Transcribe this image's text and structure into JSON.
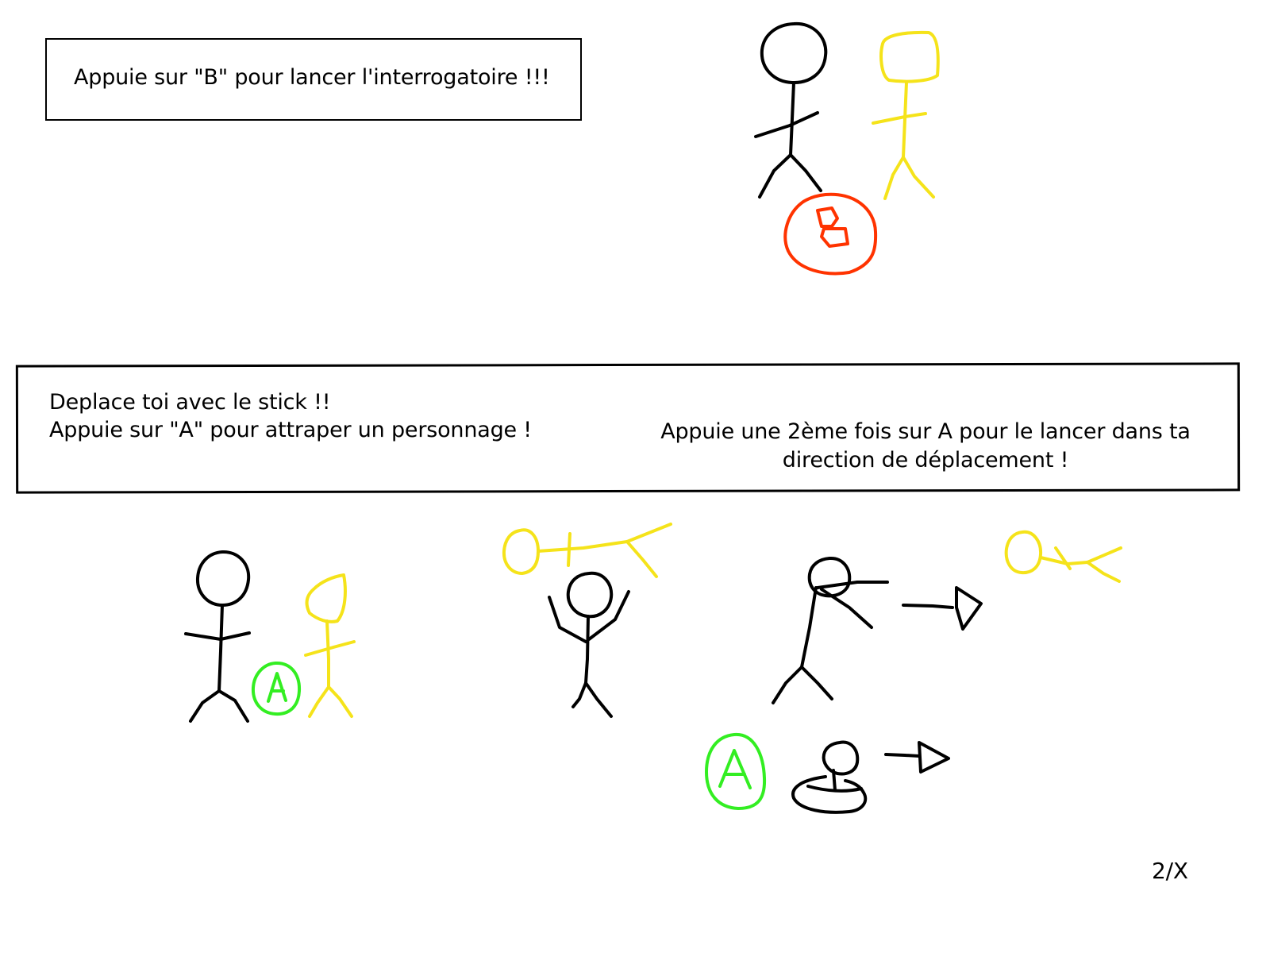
{
  "instructions": {
    "interrogate": "Appuie sur \"B\" pour lancer l'interrogatoire !!!",
    "move": "Deplace toi avec le stick !!",
    "grab": "Appuie sur \"A\" pour attraper un personnage !",
    "throw": "Appuie une 2ème fois sur A pour le lancer dans ta direction de  déplacement !"
  },
  "buttons": {
    "b_label": "B",
    "a_label": "A",
    "b_color": "#ff3300",
    "a_color": "#33ee22"
  },
  "colors": {
    "player": "#000000",
    "npc": "#f5e31a"
  },
  "page_number": "2/X"
}
